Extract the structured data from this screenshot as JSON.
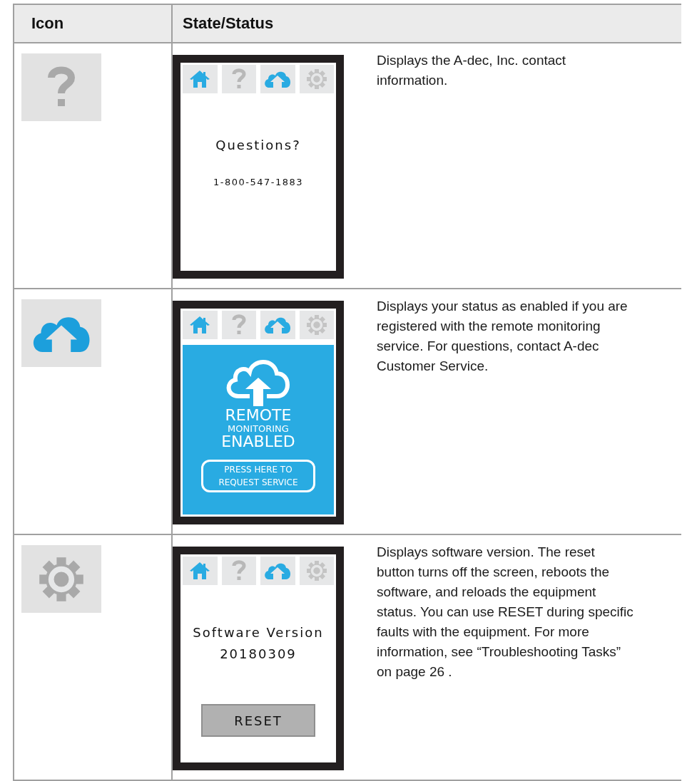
{
  "table": {
    "columns": [
      "Icon",
      "State/Status"
    ],
    "rows": [
      {
        "kind": "help",
        "screen": {
          "kind": "info",
          "tabs": [
            {
              "kind": "home"
            },
            {
              "kind": "help"
            },
            {
              "kind": "cloud"
            },
            {
              "kind": "settings"
            }
          ],
          "title": "Questions?",
          "detail": "1-800-547-1883"
        },
        "description": "Displays the A-dec, Inc. contact information."
      },
      {
        "kind": "cloud",
        "screen": {
          "kind": "remote",
          "tabs": [
            {
              "kind": "home"
            },
            {
              "kind": "help"
            },
            {
              "kind": "cloud"
            },
            {
              "kind": "settings"
            }
          ],
          "lines": [
            "REMOTE",
            "MONITORING",
            "ENABLED"
          ],
          "button": "PRESS HERE TO REQUEST SERVICE"
        },
        "description": "Displays your status as enabled if you are registered with the remote monitoring service. For questions, contact  A-dec Customer Service."
      },
      {
        "kind": "settings",
        "screen": {
          "kind": "version",
          "tabs": [
            {
              "kind": "home"
            },
            {
              "kind": "help"
            },
            {
              "kind": "cloud"
            },
            {
              "kind": "settings"
            }
          ],
          "title": "Software Version",
          "detail": "20180309",
          "button": "RESET"
        },
        "description": "Displays software version. The reset button turns off the screen, reboots the software, and reloads the equipment status. You can use RESET during specific faults with the equipment. For more information, see “Troubleshooting Tasks” on page 26 ."
      }
    ]
  }
}
